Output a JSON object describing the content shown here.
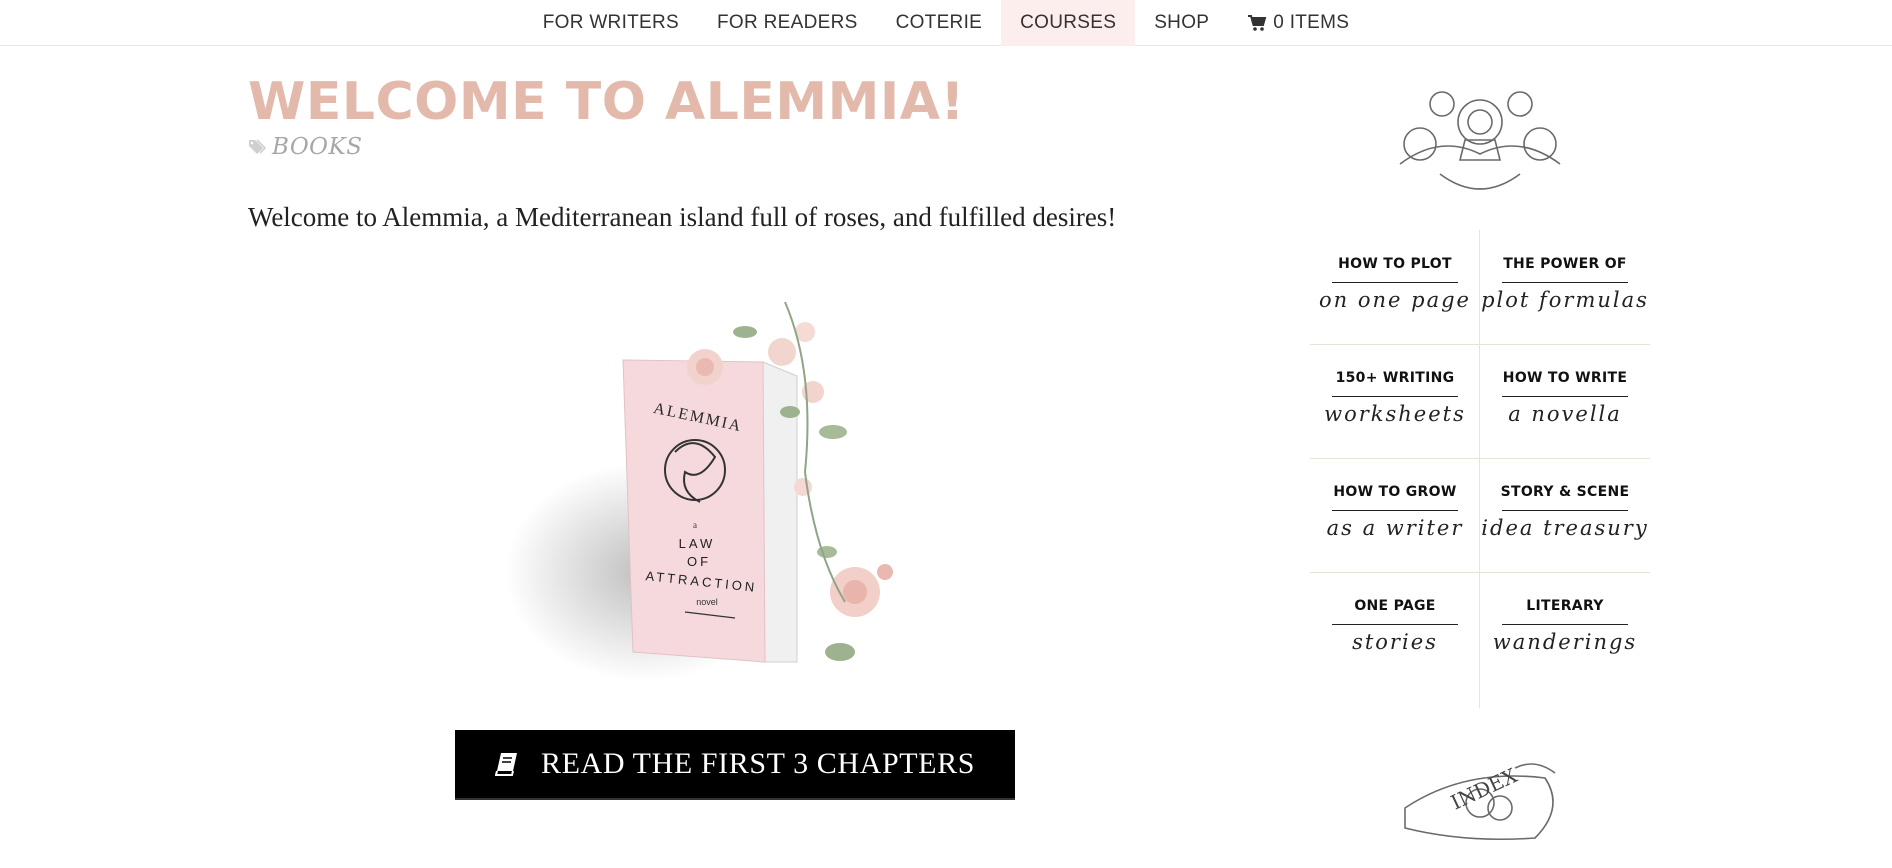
{
  "nav": {
    "items": [
      {
        "label": "FOR WRITERS"
      },
      {
        "label": "FOR READERS"
      },
      {
        "label": "COTERIE"
      },
      {
        "label": "COURSES"
      },
      {
        "label": "SHOP"
      }
    ],
    "cart_label": "0 ITEMS",
    "active_index": 3,
    "active_color": "#fdeeee"
  },
  "post": {
    "title": "WELCOME TO ALEMMIA!",
    "category": "BOOKS",
    "intro": "Welcome to Alemmia, a Mediterranean island full of roses, and fulfilled desires!"
  },
  "book": {
    "title_top": "ALEMMIA",
    "line_a": "a",
    "line_1": "LAW",
    "line_2": "OF",
    "line_3": "ATTRACTION",
    "line_novel": "novel",
    "cover_color": "#f6d9dd"
  },
  "cta": {
    "label": "READ THE FIRST 3 CHAPTERS",
    "icon": "book-icon"
  },
  "sidebar": {
    "links": [
      {
        "caption": "HOW TO PLOT",
        "script": "on one page"
      },
      {
        "caption": "THE POWER OF",
        "script": "plot formulas"
      },
      {
        "caption": "150+ WRITING",
        "script": "worksheets"
      },
      {
        "caption": "HOW TO WRITE",
        "script": "a novella"
      },
      {
        "caption": "HOW TO GROW",
        "script": "as a writer"
      },
      {
        "caption": "STORY & SCENE",
        "script": "idea treasury"
      },
      {
        "caption": "ONE PAGE",
        "script": "stories"
      },
      {
        "caption": "LITERARY",
        "script": "wanderings"
      }
    ],
    "index_label": "INDEX"
  },
  "colors": {
    "title": "#e2b9aa",
    "category": "#a7a7a7",
    "button": "#000000"
  }
}
